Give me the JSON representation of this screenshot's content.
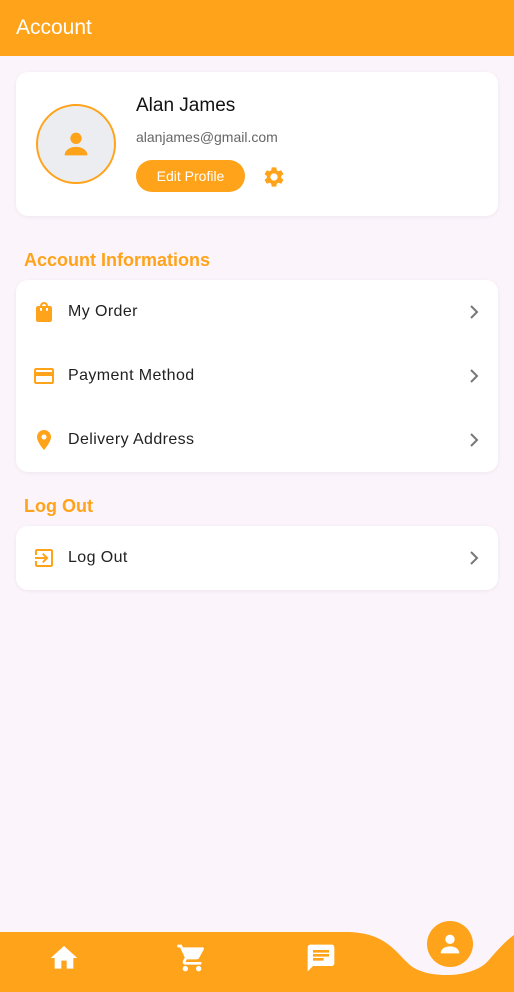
{
  "appbar": {
    "title": "Account"
  },
  "profile": {
    "name": "Alan James",
    "email": "alanjames@gmail.com",
    "edit_label": "Edit Profile",
    "avatar_icon": "person-icon",
    "settings_icon": "gear-icon"
  },
  "sections": {
    "account_title": "Account Informations",
    "logout_title": "Log Out"
  },
  "account_items": [
    {
      "label": "My Order",
      "icon": "shopping-bag-icon"
    },
    {
      "label": "Payment Method",
      "icon": "credit-card-icon"
    },
    {
      "label": "Delivery Address",
      "icon": "location-pin-icon"
    }
  ],
  "logout_item": {
    "label": "Log Out",
    "icon": "logout-icon"
  },
  "bottom_nav": {
    "items": [
      "home-icon",
      "cart-icon",
      "chat-icon",
      "person-icon"
    ],
    "active": "person-icon"
  },
  "colors": {
    "accent": "#ffa31a",
    "background": "#fcf4fb",
    "card": "#ffffff"
  }
}
